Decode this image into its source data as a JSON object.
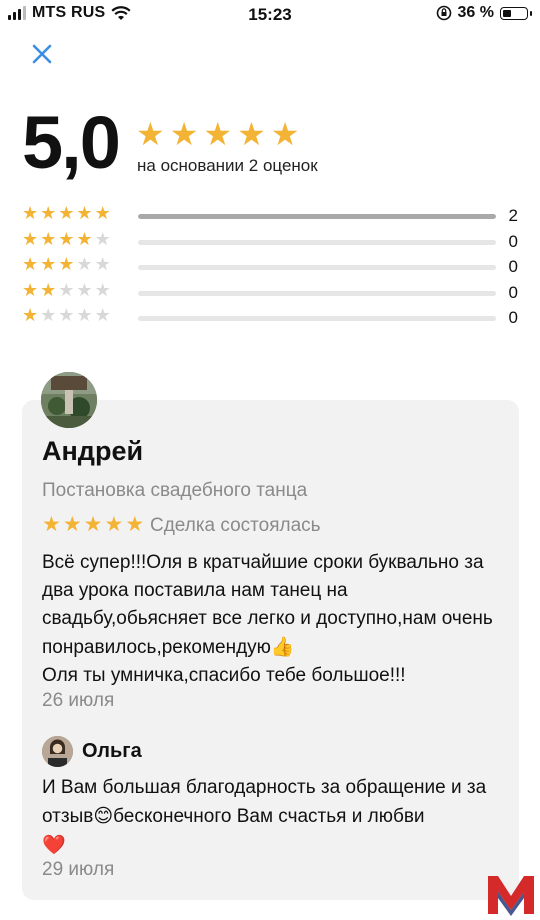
{
  "status_bar": {
    "carrier": "MTS RUS",
    "time": "15:23",
    "battery_percent": "36 %",
    "battery_level": 0.36,
    "signal_bars": 3
  },
  "header": {
    "close_icon": "close-icon"
  },
  "summary": {
    "score": "5,0",
    "stars": 5,
    "based_on": "на основании 2 оценок"
  },
  "distribution": [
    {
      "stars": 5,
      "count": "2",
      "fraction": 1.0
    },
    {
      "stars": 4,
      "count": "0",
      "fraction": 0
    },
    {
      "stars": 3,
      "count": "0",
      "fraction": 0
    },
    {
      "stars": 2,
      "count": "0",
      "fraction": 0
    },
    {
      "stars": 1,
      "count": "0",
      "fraction": 0
    }
  ],
  "review": {
    "author": "Андрей",
    "service": "Постановка свадебного танца",
    "stars": 5,
    "deal_status": "Сделка состоялась",
    "text_line1": "Всё супер!!!Оля в кратчайшие сроки буквально за два урока поставила нам танец на свадьбу,обьясняет все легко и доступно,нам очень понравилось,рекомендую",
    "text_emoji1": "👍",
    "text_line2": "Оля ты умничка,спасибо тебе большое!!!",
    "date": "26 июля",
    "reply": {
      "author": "Ольга",
      "text_part1": "И Вам большая благодарность за обращение и за отзыв",
      "emoji1": "😊",
      "text_part2": "бесконечного Вам счастья и любви",
      "emoji2": "❤️",
      "date": "29 июля"
    }
  },
  "colors": {
    "star_on": "#f3b335",
    "star_off": "#d8d8d8",
    "card_bg": "#f2f2f2",
    "muted_text": "#8a8a8a",
    "close_icon": "#3a8ee6"
  }
}
